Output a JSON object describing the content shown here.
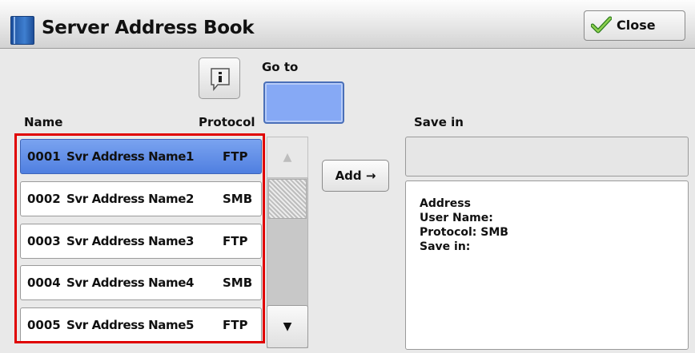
{
  "window": {
    "title": "Server Address Book",
    "close_label": "Close"
  },
  "goto": {
    "label": "Go to",
    "value": ""
  },
  "columns": {
    "name": "Name",
    "protocol": "Protocol",
    "save_in": "Save in"
  },
  "entries": [
    {
      "number": "0001",
      "name": "Svr Address Name1",
      "protocol": "FTP",
      "selected": true
    },
    {
      "number": "0002",
      "name": "Svr Address Name2",
      "protocol": "SMB",
      "selected": false
    },
    {
      "number": "0003",
      "name": "Svr Address Name3",
      "protocol": "FTP",
      "selected": false
    },
    {
      "number": "0004",
      "name": "Svr Address Name4",
      "protocol": "SMB",
      "selected": false
    },
    {
      "number": "0005",
      "name": "Svr Address Name5",
      "protocol": "FTP",
      "selected": false
    }
  ],
  "scroll": {
    "up_symbol": "▲",
    "down_symbol": "▼"
  },
  "add_label": "Add →",
  "save_in_value": "",
  "details": {
    "address": "Address",
    "user_name": "User Name:",
    "protocol": "Protocol: SMB",
    "save_in": "Save in:"
  },
  "icons": {
    "title": "address-book-icon",
    "close": "checkmark-icon",
    "info": "info-icon"
  },
  "colors": {
    "selected_row": "#5f8ee8",
    "goto_field": "#86a9f5",
    "highlight_border": "#e00000"
  }
}
